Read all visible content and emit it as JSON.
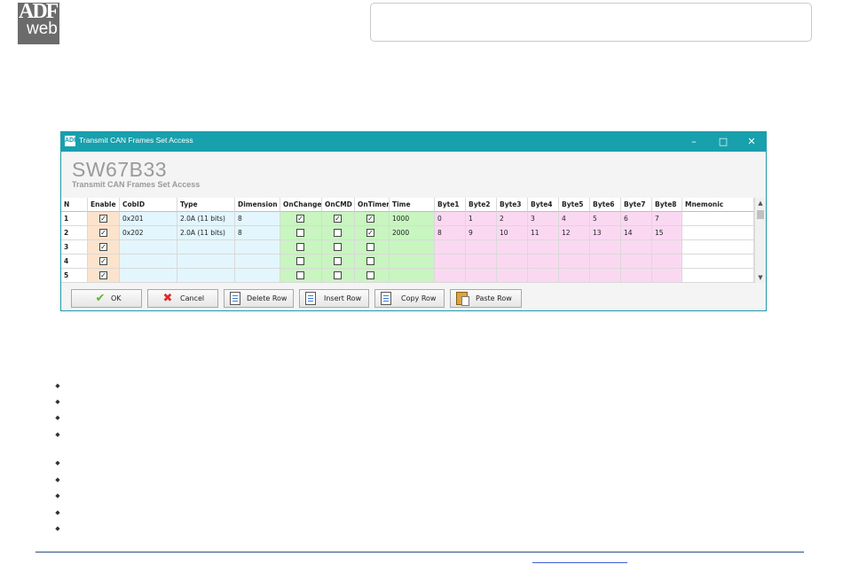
{
  "logo": {
    "line1": "ADF",
    "line2": "web"
  },
  "window": {
    "title": "Transmit CAN Frames Set Access",
    "app_icon": "ADF",
    "controls": {
      "minimize": "–",
      "maximize": "□",
      "close": "✕"
    },
    "product": "SW67B33",
    "subtitle": "Transmit CAN Frames Set Access"
  },
  "grid": {
    "headers": [
      "N",
      "Enable",
      "CobID",
      "Type",
      "Dimension",
      "OnChange",
      "OnCMD",
      "OnTimer",
      "Time",
      "Byte1",
      "Byte2",
      "Byte3",
      "Byte4",
      "Byte5",
      "Byte6",
      "Byte7",
      "Byte8",
      "Mnemonic"
    ],
    "rows": [
      {
        "n": "1",
        "enable": true,
        "cobid": "0x201",
        "type": "2.0A (11 bits)",
        "dimension": "8",
        "onchange": true,
        "oncmd": true,
        "ontimer": true,
        "time": "1000",
        "bytes": [
          "0",
          "1",
          "2",
          "3",
          "4",
          "5",
          "6",
          "7"
        ],
        "mnemonic": ""
      },
      {
        "n": "2",
        "enable": true,
        "cobid": "0x202",
        "type": "2.0A (11 bits)",
        "dimension": "8",
        "onchange": false,
        "oncmd": false,
        "ontimer": true,
        "time": "2000",
        "bytes": [
          "8",
          "9",
          "10",
          "11",
          "12",
          "13",
          "14",
          "15"
        ],
        "mnemonic": ""
      },
      {
        "n": "3",
        "enable": true,
        "cobid": "",
        "type": "",
        "dimension": "",
        "onchange": false,
        "oncmd": false,
        "ontimer": false,
        "time": "",
        "bytes": [
          "",
          "",
          "",
          "",
          "",
          "",
          "",
          ""
        ],
        "mnemonic": ""
      },
      {
        "n": "4",
        "enable": true,
        "cobid": "",
        "type": "",
        "dimension": "",
        "onchange": false,
        "oncmd": false,
        "ontimer": false,
        "time": "",
        "bytes": [
          "",
          "",
          "",
          "",
          "",
          "",
          "",
          ""
        ],
        "mnemonic": ""
      },
      {
        "n": "5",
        "enable": true,
        "cobid": "",
        "type": "",
        "dimension": "",
        "onchange": false,
        "oncmd": false,
        "ontimer": false,
        "time": "",
        "bytes": [
          "",
          "",
          "",
          "",
          "",
          "",
          "",
          ""
        ],
        "mnemonic": ""
      }
    ],
    "check_glyph": "✓"
  },
  "buttons": {
    "ok": "OK",
    "cancel": "Cancel",
    "delete_row": "Delete Row",
    "insert_row": "Insert Row",
    "copy_row": "Copy Row",
    "paste_row": "Paste Row"
  },
  "colors": {
    "titlebar": "#18a0ad",
    "enable_col": "#fde3cc",
    "id_cols": "#e3f6fd",
    "trigger_cols": "#c8f5c0",
    "byte_cols": "#fbd8f2"
  }
}
